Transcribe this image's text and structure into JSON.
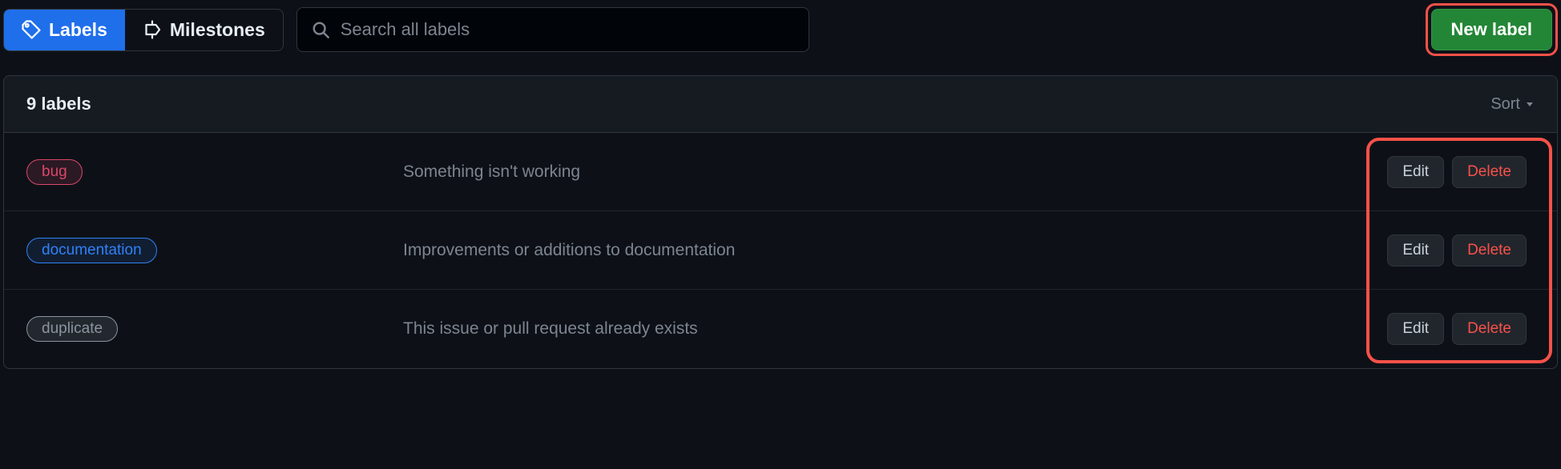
{
  "toolbar": {
    "labels_tab": "Labels",
    "milestones_tab": "Milestones",
    "search_placeholder": "Search all labels",
    "new_label": "New label"
  },
  "list": {
    "count_text": "9 labels",
    "sort_label": "Sort",
    "edit_label": "Edit",
    "delete_label": "Delete",
    "items": [
      {
        "name": "bug",
        "description": "Something isn't working",
        "color": "#d9476a",
        "bg": "rgba(217,71,106,0.15)"
      },
      {
        "name": "documentation",
        "description": "Improvements or additions to documentation",
        "color": "#2f81f7",
        "bg": "rgba(47,129,247,0.12)"
      },
      {
        "name": "duplicate",
        "description": "This issue or pull request already exists",
        "color": "#8b949e",
        "bg": "rgba(139,148,158,0.18)"
      }
    ]
  }
}
